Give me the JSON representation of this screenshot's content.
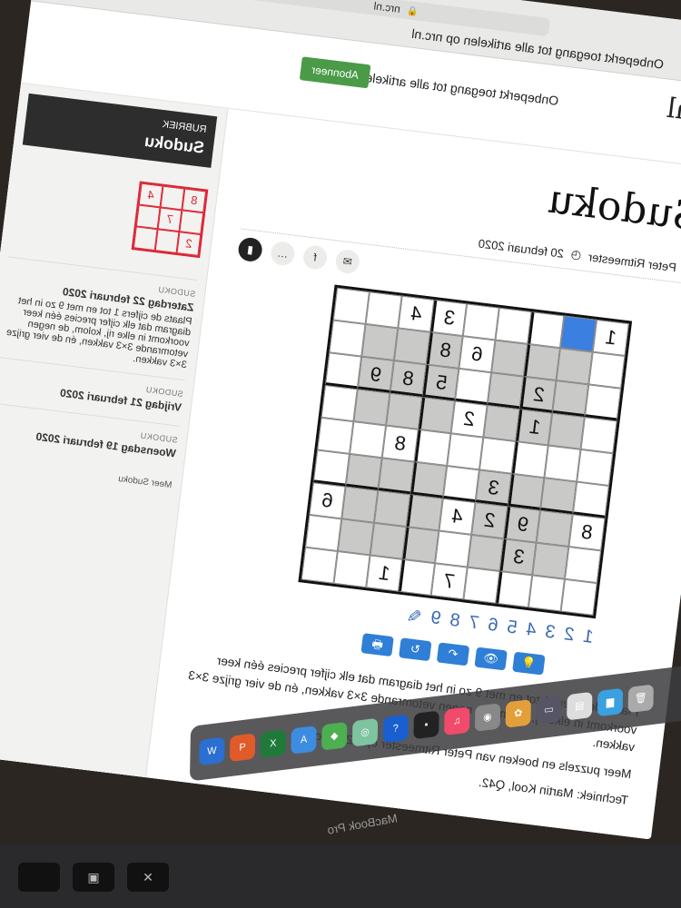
{
  "browser": {
    "url": "nrc.nl",
    "banner": "Onbeperkt toegang tot alle artikelen op nrc.nl"
  },
  "site": {
    "logo": ".nl",
    "logo_chevron": "›",
    "promo": "Onbeperkt toegang tot alle artikelen op nrc.nl",
    "subscribe": "Abonneer"
  },
  "article": {
    "title": "Sudoku",
    "author": "Peter Ritmeester",
    "date": "20 februari 2020",
    "share": [
      "✉",
      "f",
      "…",
      "▮"
    ]
  },
  "puzzle": {
    "rows": [
      [
        "1",
        "",
        "",
        "",
        "",
        "3",
        "4",
        "",
        ""
      ],
      [
        "",
        "",
        "",
        "",
        "6",
        "8",
        "",
        "",
        ""
      ],
      [
        "",
        "",
        "2",
        "",
        "",
        "5",
        "8",
        "9",
        ""
      ],
      [
        "",
        "",
        "1",
        "",
        "2",
        "",
        "",
        "",
        ""
      ],
      [
        "",
        "",
        "",
        "",
        "",
        "",
        "8",
        "",
        ""
      ],
      [
        "",
        "",
        "",
        "3",
        "",
        "",
        "",
        "",
        ""
      ],
      [
        "8",
        "",
        "9",
        "2",
        "4",
        "",
        "",
        "",
        "6"
      ],
      [
        "",
        "",
        "3",
        "",
        "",
        "",
        "",
        "",
        ""
      ],
      [
        "",
        "",
        "",
        "",
        "7",
        "",
        "1",
        "",
        ""
      ]
    ],
    "selected": [
      0,
      1
    ],
    "numpad": [
      "1",
      "2",
      "3",
      "4",
      "5",
      "6",
      "7",
      "8",
      "9"
    ]
  },
  "tools": [
    "💡",
    "👁",
    "↶",
    "↻",
    "🖶"
  ],
  "description": {
    "p1": "Plaats de cijfers 1 tot en met 9 zo in het diagram dat elk cijfer precies één keer voorkomt in elke rij, kolom, de negen vetomrande 3×3 vakken, én de vier grijze 3×3 vakken.",
    "p2": "Meer puzzels en boeken van Peter Ritmeester op PZZL.com.",
    "p3": "Techniek: Martin Kool, Q42."
  },
  "sidebar": {
    "rubriek_label": "RUBRIEK",
    "rubriek_title": "Sudoku",
    "mini": [
      "8",
      "",
      "4",
      "",
      "7",
      "",
      "2",
      "",
      ""
    ],
    "cards": [
      {
        "kicker": "SUDOKU",
        "date": "Zaterdag 22 februari 2020",
        "text": "Plaats de cijfers 1 tot en met 9 zo in het diagram dat elk cijfer precies één keer voorkomt in elke rij, kolom, de negen vetomrande 3×3 vakken, én de vier grijze 3×3 vakken."
      },
      {
        "kicker": "SUDOKU",
        "date": "Vrijdag 21 februari 2020",
        "text": ""
      },
      {
        "kicker": "SUDOKU",
        "date": "Woensdag 19 februari 2020",
        "text": ""
      }
    ],
    "more": "Meer Sudoku"
  },
  "device": {
    "brand": "MacBook Pro"
  },
  "colors": {
    "selected": "#3b7fe0",
    "accent": "#d32027",
    "subscribe": "#4a9a48"
  }
}
